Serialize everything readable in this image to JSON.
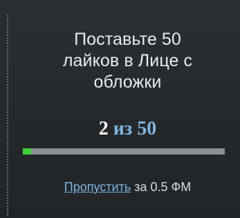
{
  "task": {
    "title_lines": [
      "Поставьте 50",
      "лайков в Лице с",
      "обложки"
    ]
  },
  "progress": {
    "current": "2",
    "separator": "из",
    "total": "50",
    "fraction": 0.04
  },
  "skip": {
    "link_label": "Пропустить",
    "cost_text": "за 0.5 ФМ"
  },
  "colors": {
    "background": "#24282b",
    "accent": "#7fb4de",
    "progress_fill": "#3fd23a",
    "progress_track": "#8a9094"
  }
}
